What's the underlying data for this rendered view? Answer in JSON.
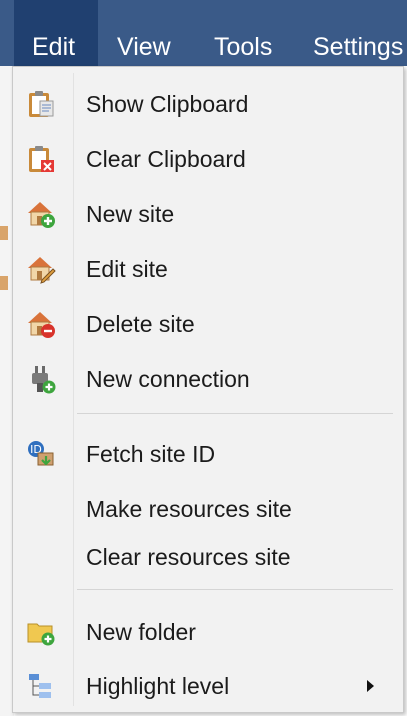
{
  "menubar": {
    "items": [
      {
        "label": "Edit"
      },
      {
        "label": "View"
      },
      {
        "label": "Tools"
      },
      {
        "label": "Settings"
      }
    ]
  },
  "dropdown": {
    "groups": [
      [
        {
          "label": "Show Clipboard",
          "icon": "clipboard-icon"
        },
        {
          "label": "Clear Clipboard",
          "icon": "clipboard-clear-icon"
        },
        {
          "label": "New site",
          "icon": "house-add-icon"
        },
        {
          "label": "Edit site",
          "icon": "house-edit-icon"
        },
        {
          "label": "Delete site",
          "icon": "house-delete-icon"
        },
        {
          "label": "New connection",
          "icon": "plug-add-icon"
        }
      ],
      [
        {
          "label": "Fetch site ID",
          "icon": "fetch-id-icon"
        },
        {
          "label": "Make resources site",
          "icon": ""
        },
        {
          "label": "Clear resources site",
          "icon": ""
        }
      ],
      [
        {
          "label": "New folder",
          "icon": "folder-add-icon"
        },
        {
          "label": "Highlight level",
          "icon": "hierarchy-icon",
          "submenu": true
        }
      ]
    ]
  }
}
